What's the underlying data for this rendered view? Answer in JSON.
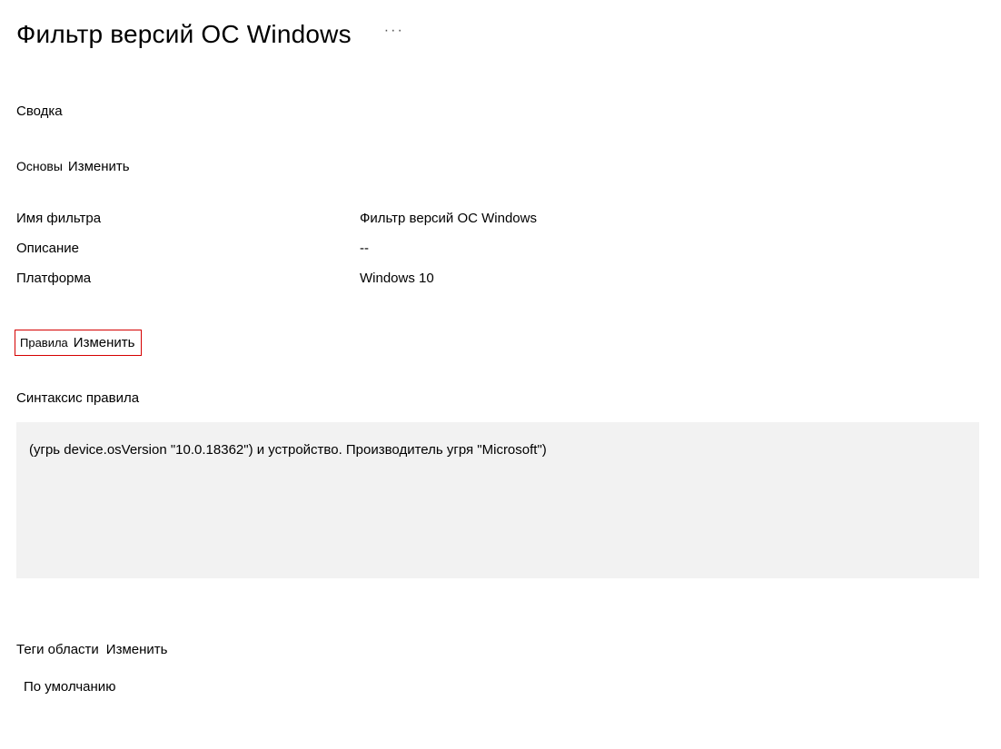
{
  "header": {
    "title": "Фильтр версий ОС Windows",
    "more": "···"
  },
  "summary": {
    "label": "Сводка"
  },
  "basics": {
    "section_name": "Основы",
    "edit": "Изменить",
    "fields": {
      "filter_name": {
        "label": "Имя фильтра",
        "value": "Фильтр версий ОС Windows"
      },
      "description": {
        "label": "Описание",
        "value": "--"
      },
      "platform": {
        "label": "Платформа",
        "value": "Windows 10"
      }
    }
  },
  "rules": {
    "section_name": "Правила",
    "edit": "Изменить",
    "syntax_label": "Синтаксис правила",
    "syntax_value": "(угрь device.osVersion \"10.0.18362\") и устройство. Производитель угря \"Microsoft\")"
  },
  "scope_tags": {
    "label": "Теги области",
    "edit": "Изменить",
    "value": "По умолчанию"
  }
}
